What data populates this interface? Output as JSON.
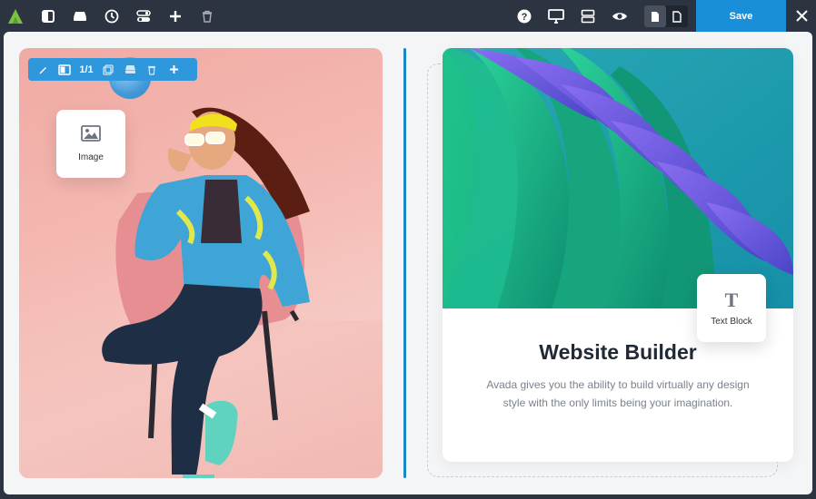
{
  "app": {
    "logo_icon": "avada-logo-icon",
    "accent_color": "#198fd9"
  },
  "toolbar": {
    "left_icons": [
      "sidebar-toggle-icon",
      "container-icon",
      "history-icon",
      "toggles-icon",
      "add-icon",
      "trash-icon"
    ],
    "right_icons": [
      "help-icon",
      "desktop-preview-icon",
      "layout-rows-icon",
      "eye-icon"
    ],
    "save_label": "Save",
    "close_icon": "close-icon"
  },
  "element_toolbar": {
    "counter": "1/1",
    "icons": [
      "edit-icon",
      "column-icon",
      "clone-icon",
      "container-icon",
      "trash-icon",
      "add-icon"
    ]
  },
  "widgets": {
    "image_label": "Image",
    "text_block_label": "Text Block"
  },
  "card": {
    "title": "Website Builder",
    "description": "Avada gives you the ability to build virtually any design style with the only limits being your imagination."
  }
}
